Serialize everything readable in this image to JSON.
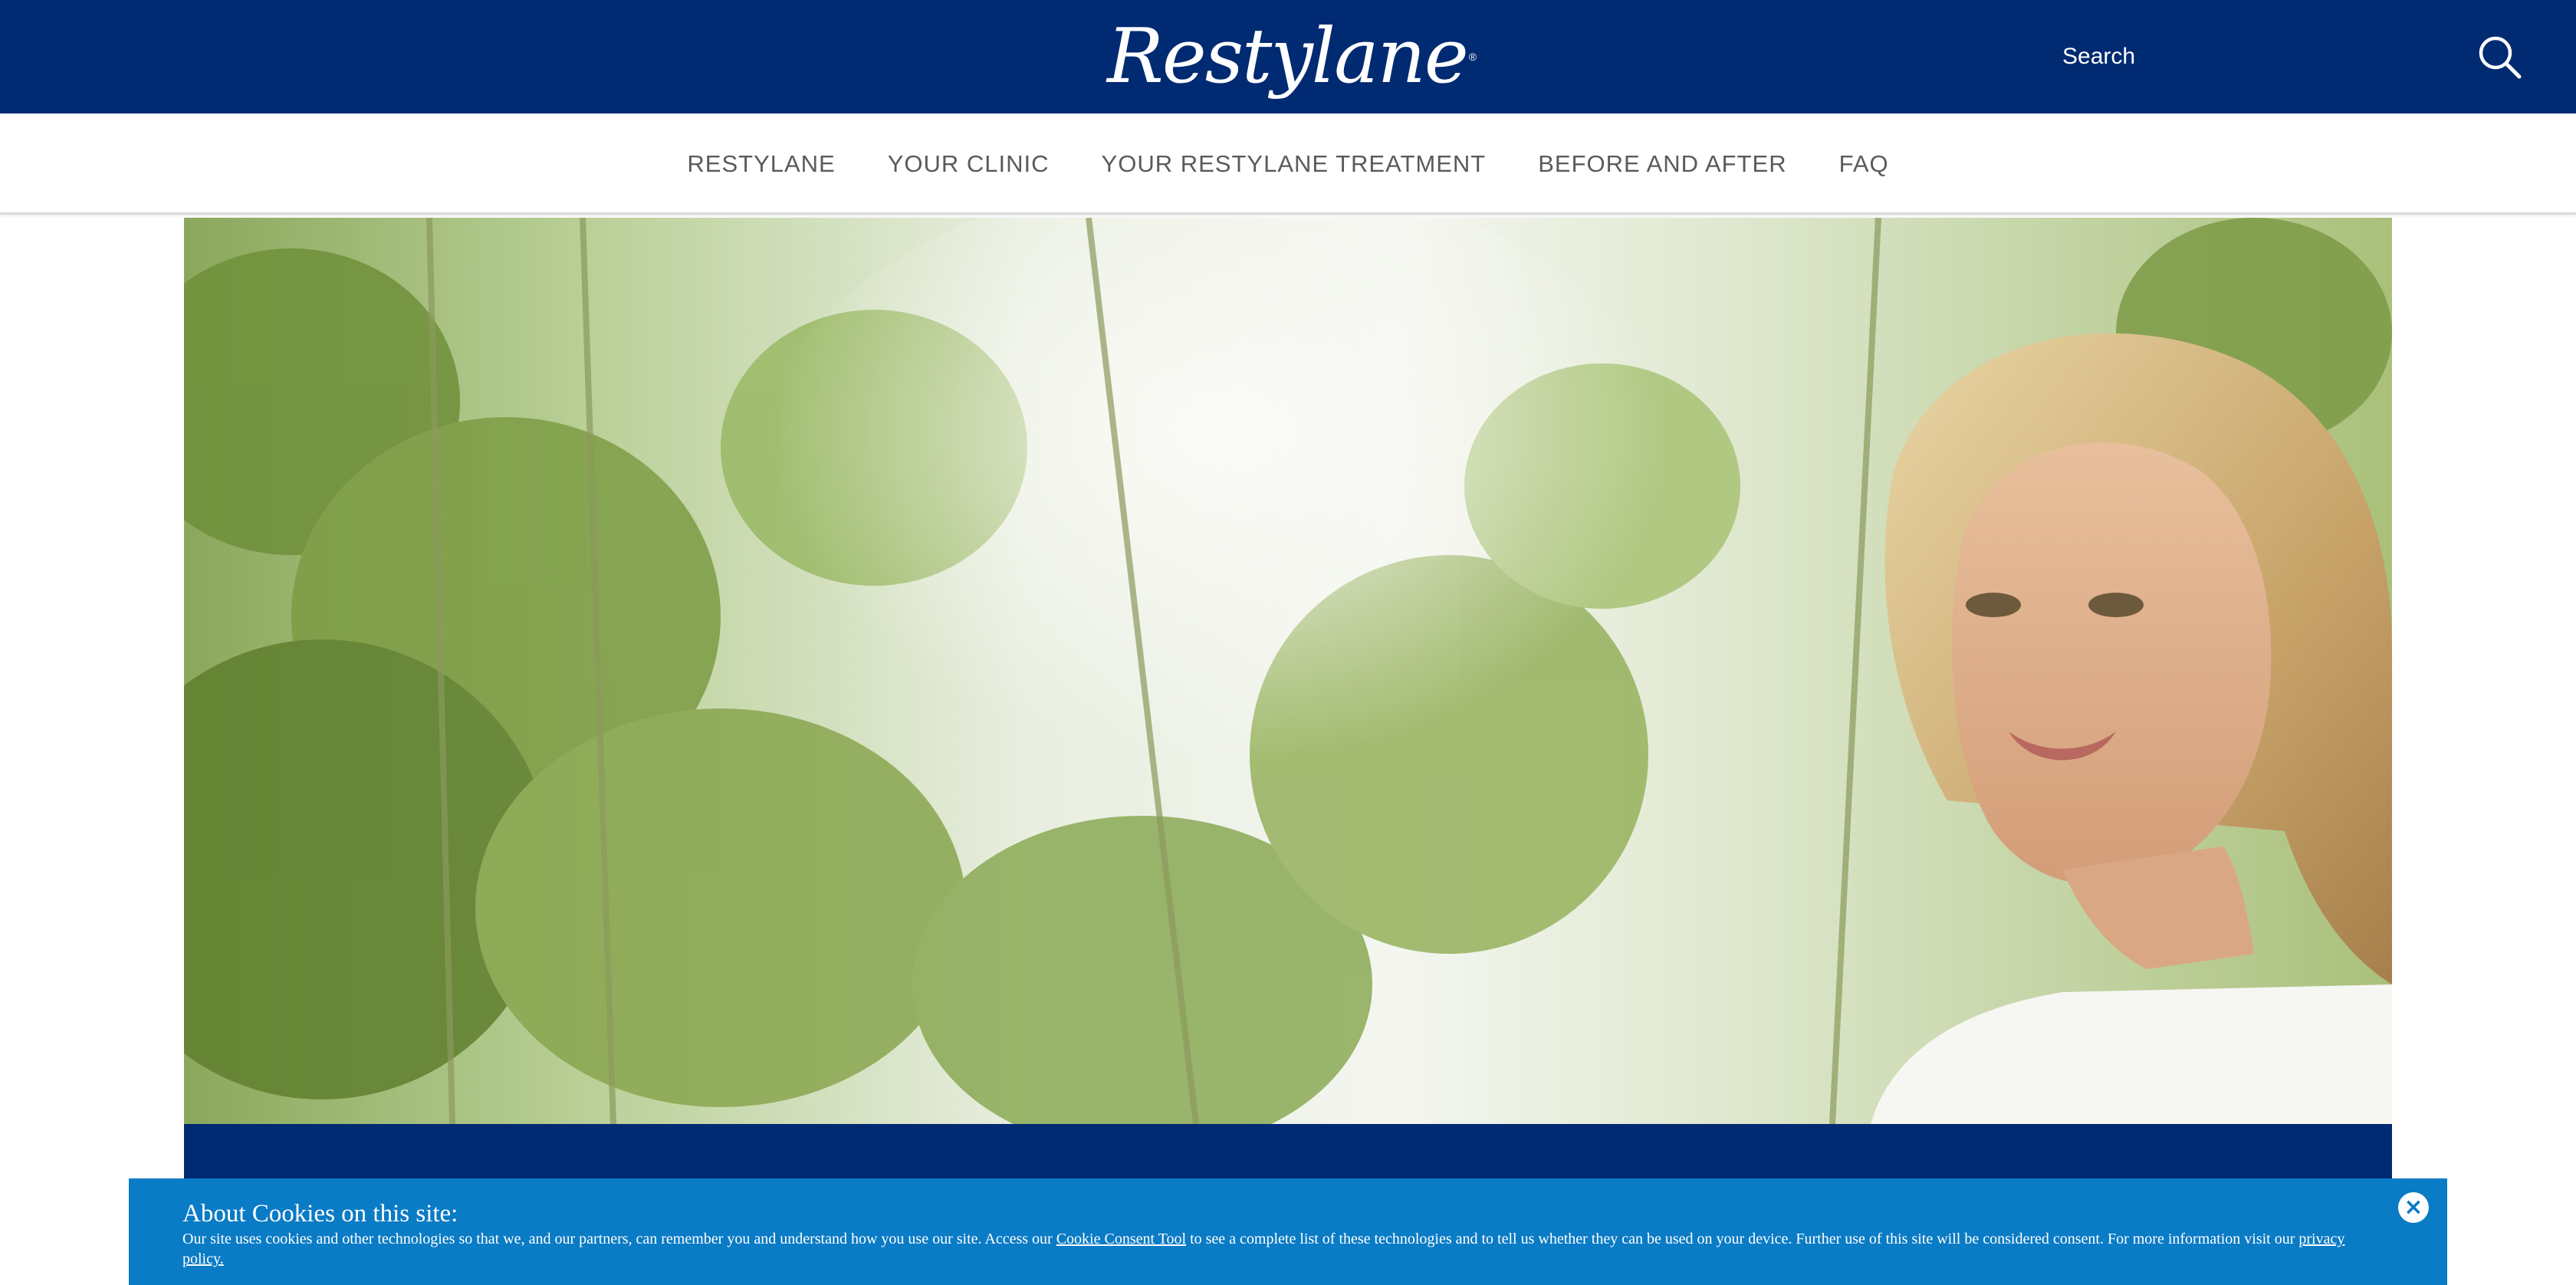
{
  "header": {
    "logo_text": "Restylane",
    "logo_mark": "®",
    "search_placeholder": "Search",
    "search_icon": "search-icon",
    "bg_color": "#002a72"
  },
  "nav": {
    "items": [
      {
        "label": "RESTYLANE"
      },
      {
        "label": "YOUR CLINIC"
      },
      {
        "label": "YOUR RESTYLANE TREATMENT"
      },
      {
        "label": "BEFORE AND AFTER"
      },
      {
        "label": "FAQ"
      }
    ]
  },
  "hero": {
    "image": "hero-photo"
  },
  "cookie": {
    "title": "About Cookies on this site:",
    "body_before": "Our site uses cookies and other technologies so that we, and our partners, can remember you and understand how you use our site. Access our ",
    "consent_link": "Cookie Consent Tool",
    "body_middle": " to see a complete list of these technologies and to tell us whether they can be used on your device. Further use of this site will be considered consent. For more information visit our ",
    "privacy_link": "privacy policy.",
    "close_icon": "close-icon",
    "bg_color": "#0a7bc5"
  }
}
